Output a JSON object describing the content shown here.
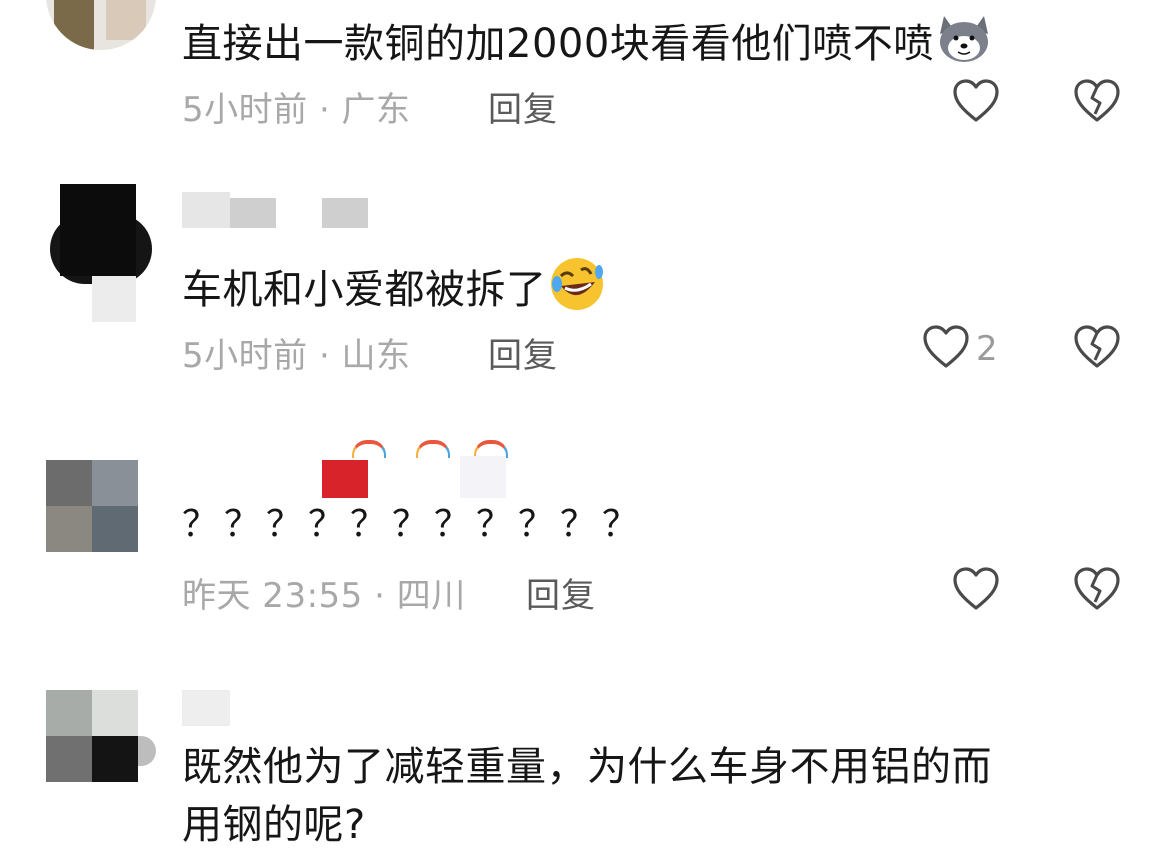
{
  "comments": [
    {
      "text": "直接出一款铜的加2000块看看他们喷不喷",
      "time_location": "5小时前 · 广东",
      "reply_label": "回复",
      "like_count": "",
      "emoji": "husky-dog-emoji"
    },
    {
      "text": "车机和小爱都被拆了",
      "time_location": "5小时前 · 山东",
      "reply_label": "回复",
      "like_count": "2",
      "emoji": "rofl-emoji"
    },
    {
      "text": "？？？？？？？？？？？",
      "time_location": "昨天 23:55 · 四川",
      "reply_label": "回复",
      "like_count": "",
      "emoji": ""
    },
    {
      "text_line1": "既然他为了减轻重量，为什么车身不用铝的而",
      "text_line2": "用钢的呢?",
      "time_location": "",
      "reply_label": "",
      "like_count": "",
      "emoji": ""
    }
  ],
  "icons": {
    "like": "heart-outline-icon",
    "dislike": "broken-heart-outline-icon"
  },
  "colors": {
    "text": "#161616",
    "meta": "#a8a8a8",
    "reply": "#5a5a5a",
    "icon": "#4a4a4a"
  }
}
